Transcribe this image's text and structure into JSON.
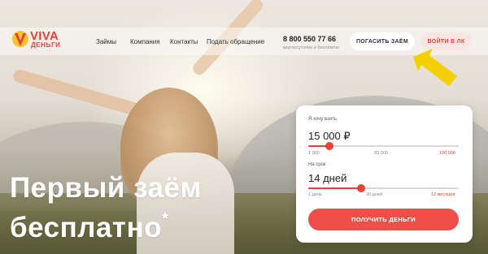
{
  "brand": {
    "name": "VIVA",
    "subtitle": "ДЕНЬГИ",
    "accent_color": "#e8413a"
  },
  "nav": {
    "items": [
      "Займы",
      "Компания",
      "Контакты",
      "Подать обращение"
    ]
  },
  "contact": {
    "phone": "8 800 550 77 66",
    "note": "круглосуточно и бесплатно"
  },
  "header_buttons": {
    "repay": "ПОГАСИТЬ ЗАЁМ",
    "login": "ВОЙТИ В ЛК"
  },
  "hero": {
    "line1": "Первый заём",
    "line2": "бесплатно",
    "footnote": "*"
  },
  "annotation": {
    "icon": "arrow-up-icon",
    "color": "#f5d000"
  },
  "calculator": {
    "amount": {
      "label": "Я хочу взять",
      "value": "15 000 ₽",
      "position_fraction": 0.14,
      "ticks": [
        "1 000",
        "50 000",
        "100 000"
      ]
    },
    "term": {
      "label": "На срок",
      "value": "14 дней",
      "position_fraction": 0.35,
      "ticks": [
        "1 день",
        "30 дней",
        "12 месяцев"
      ]
    },
    "submit": "ПОЛУЧИТЬ ДЕНЬГИ"
  }
}
